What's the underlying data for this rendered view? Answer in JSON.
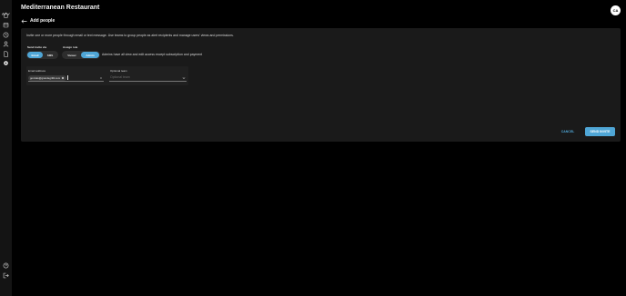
{
  "app": {
    "logo_icon": "app-logo-icon"
  },
  "sidebar": {
    "items": [
      {
        "icon": "home-icon"
      },
      {
        "icon": "box-icon"
      },
      {
        "icon": "clock-icon"
      },
      {
        "icon": "person-icon"
      },
      {
        "icon": "document-icon"
      },
      {
        "icon": "gear-icon"
      }
    ],
    "bottom": [
      {
        "icon": "help-icon"
      },
      {
        "icon": "logout-icon"
      }
    ]
  },
  "header": {
    "title": "Mediterranean Restaurant",
    "avatar_initials": "CA"
  },
  "page": {
    "back_icon": "arrow-left-icon",
    "title": "Add people"
  },
  "invite": {
    "intro": "Invite one or more people through email or text message. Use teams to group people as alert recipients and manage users' views and permissions.",
    "send_via": {
      "label": "Send invite via",
      "options": [
        "Email",
        "SMS"
      ],
      "selected": "Email"
    },
    "role": {
      "label": "Assign role",
      "options": [
        "Viewer",
        "Admin"
      ],
      "selected": "Admin",
      "note": "Admins have all view and edit access except subscription and payment"
    },
    "email": {
      "label": "Email address",
      "chips": [
        "gonzalo@grandegrillit.com"
      ]
    },
    "team": {
      "label": "Optional team",
      "placeholder": "Optional team"
    }
  },
  "actions": {
    "cancel": "CANCEL",
    "send": "SEND INVITE"
  },
  "colors": {
    "accent": "#4fa6d6",
    "background": "#000000",
    "card": "#1a1a1a",
    "sidebar": "#141414"
  }
}
